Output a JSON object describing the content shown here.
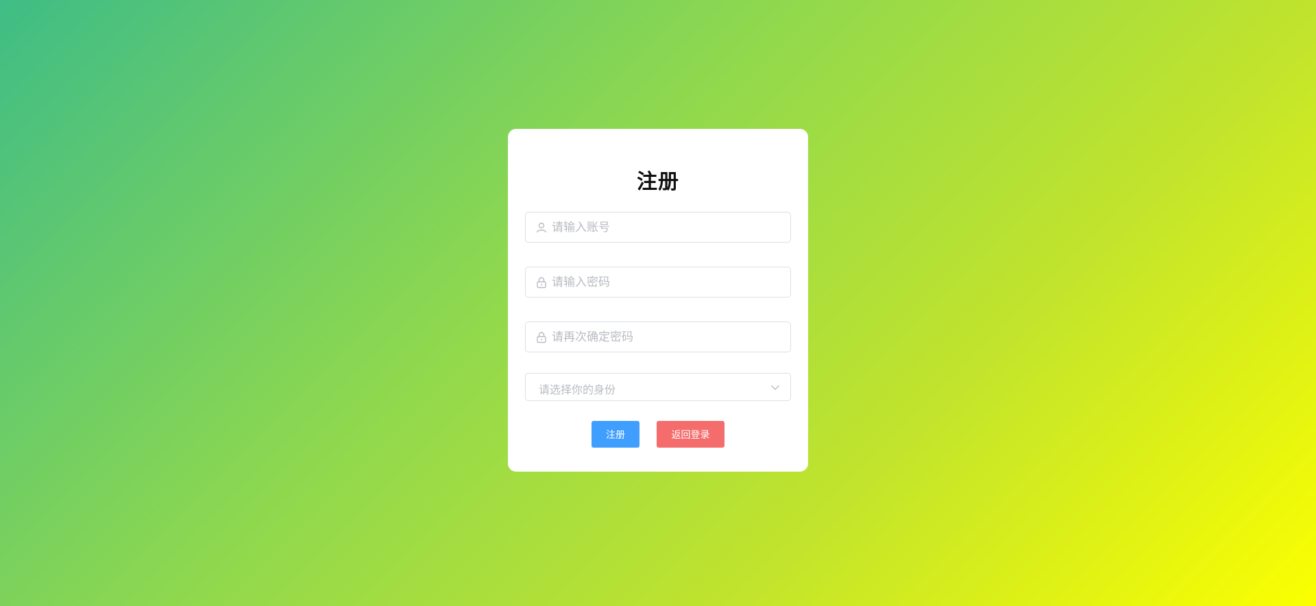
{
  "form": {
    "title": "注册",
    "account_placeholder": "请输入账号",
    "password_placeholder": "请输入密码",
    "confirm_placeholder": "请再次确定密码",
    "role_placeholder": "请选择你的身份",
    "register_label": "注册",
    "back_label": "返回登录"
  },
  "icons": {
    "account": "user-icon",
    "password": "lock-icon",
    "confirm": "lock-icon",
    "role": "chevron-down-icon"
  },
  "colors": {
    "primary": "#409eff",
    "danger": "#f56c6c",
    "gradient_start": "#3fbd86",
    "gradient_end": "#fbff00"
  }
}
